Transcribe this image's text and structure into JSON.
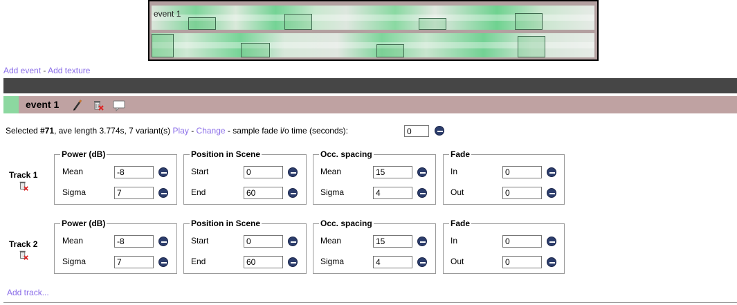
{
  "timeline": {
    "event_label": "event 1"
  },
  "links": {
    "add_event": "Add event",
    "separator": " - ",
    "add_texture": "Add texture",
    "add_track": "Add track..."
  },
  "event": {
    "title": "event 1",
    "swatch_color": "#8cd8a0",
    "icons": [
      "pencil-icon",
      "trash-icon",
      "comment-icon"
    ]
  },
  "selection": {
    "prefix": "Selected ",
    "id": "#71",
    "details": ", ave length 3.774s, 7 variant(s) ",
    "play": "Play",
    "dash": " - ",
    "change": "Change",
    "suffix": " - sample fade i/o time (seconds):",
    "fade_io_value": "0"
  },
  "tracks": [
    {
      "label": "Track 1",
      "power": {
        "legend": "Power (dB)",
        "mean_label": "Mean",
        "mean": "-8",
        "sigma_label": "Sigma",
        "sigma": "7"
      },
      "position": {
        "legend": "Position in Scene",
        "start_label": "Start",
        "start": "0",
        "end_label": "End",
        "end": "60"
      },
      "spacing": {
        "legend": "Occ. spacing",
        "mean_label": "Mean",
        "mean": "15",
        "sigma_label": "Sigma",
        "sigma": "4"
      },
      "fade": {
        "legend": "Fade",
        "in_label": "In",
        "in": "0",
        "out_label": "Out",
        "out": "0"
      }
    },
    {
      "label": "Track 2",
      "power": {
        "legend": "Power (dB)",
        "mean_label": "Mean",
        "mean": "-8",
        "sigma_label": "Sigma",
        "sigma": "7"
      },
      "position": {
        "legend": "Position in Scene",
        "start_label": "Start",
        "start": "0",
        "end_label": "End",
        "end": "60"
      },
      "spacing": {
        "legend": "Occ. spacing",
        "mean_label": "Mean",
        "mean": "15",
        "sigma_label": "Sigma",
        "sigma": "4"
      },
      "fade": {
        "legend": "Fade",
        "in_label": "In",
        "in": "0",
        "out_label": "Out",
        "out": "0"
      }
    }
  ],
  "colors": {
    "link": "#8a6de8",
    "dark_bar": "#464646",
    "event_header": "#bfa2a2",
    "button": "#2c3d6c"
  }
}
